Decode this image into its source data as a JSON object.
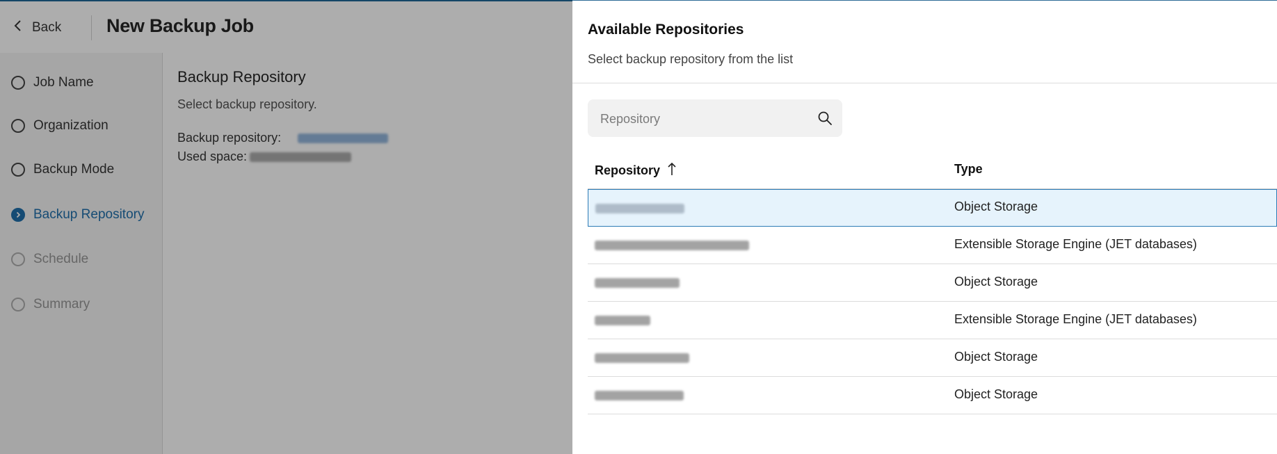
{
  "header": {
    "back_label": "Back",
    "title": "New Backup Job"
  },
  "steps": [
    {
      "label": "Job Name",
      "state": "done"
    },
    {
      "label": "Organization",
      "state": "done"
    },
    {
      "label": "Backup Mode",
      "state": "done"
    },
    {
      "label": "Backup Repository",
      "state": "current"
    },
    {
      "label": "Schedule",
      "state": "pending"
    },
    {
      "label": "Summary",
      "state": "pending"
    }
  ],
  "content": {
    "title": "Backup Repository",
    "description": "Select backup repository.",
    "repo_label": "Backup repository:",
    "used_space_label": "Used space:"
  },
  "drawer": {
    "title": "Available Repositories",
    "subtitle": "Select backup repository from the list",
    "search_placeholder": "Repository",
    "columns": {
      "repository": "Repository",
      "type": "Type"
    },
    "rows": [
      {
        "type": "Object Storage",
        "selected": true
      },
      {
        "type": "Extensible Storage Engine (JET databases)",
        "selected": false
      },
      {
        "type": "Object Storage",
        "selected": false
      },
      {
        "type": "Extensible Storage Engine (JET databases)",
        "selected": false
      },
      {
        "type": "Object Storage",
        "selected": false
      },
      {
        "type": "Object Storage",
        "selected": false
      }
    ]
  },
  "colors": {
    "accent": "#0b62a4",
    "selected_row_bg": "#e6f3fc",
    "selected_row_border": "#2c7bb6"
  }
}
